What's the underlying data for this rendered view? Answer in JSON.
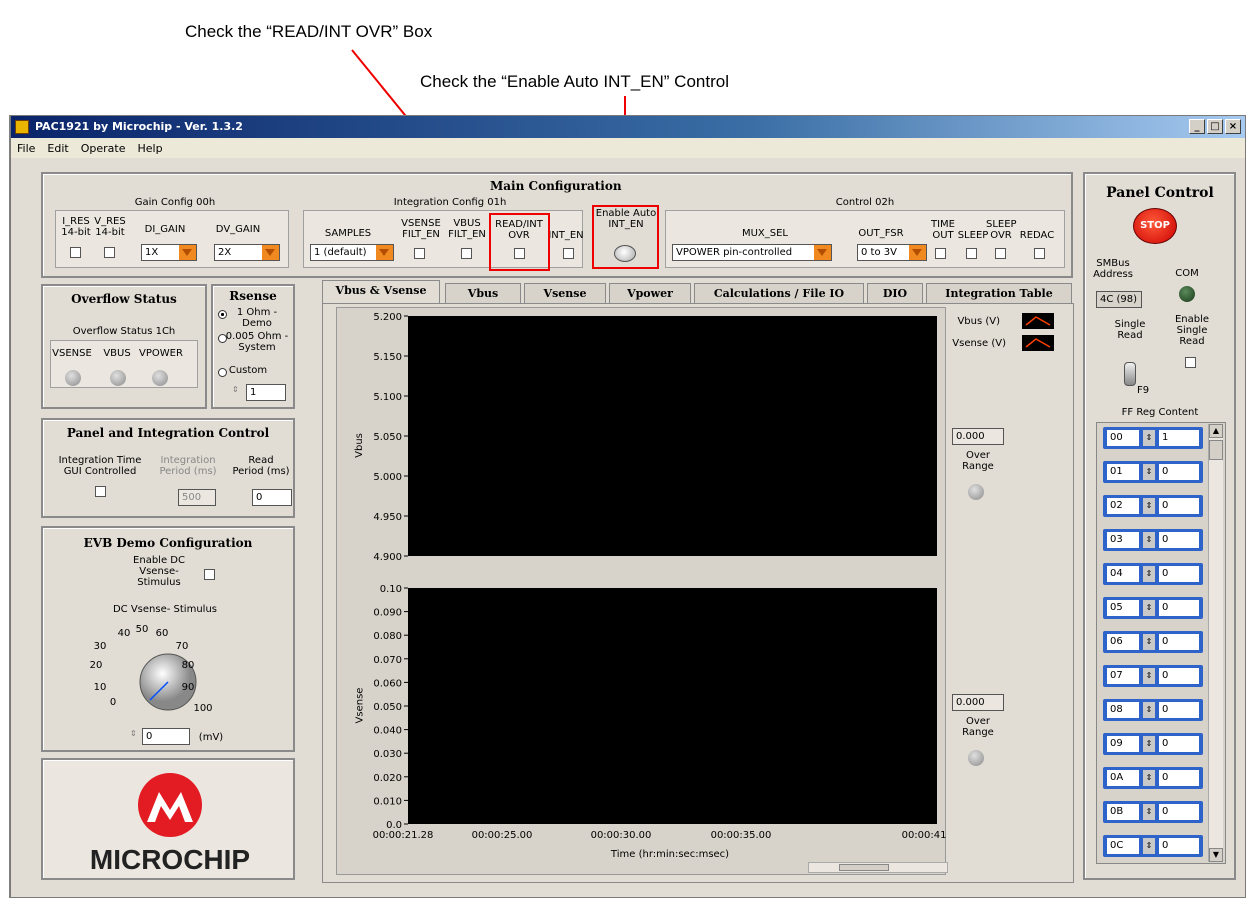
{
  "callouts": {
    "read_int_ovr": "Check the “READ/INT OVR” Box",
    "auto_int_en": "Check the “Enable Auto INT_EN” Control"
  },
  "window": {
    "title": "PAC1921 by Microchip - Ver. 1.3.2",
    "menu": [
      "File",
      "Edit",
      "Operate",
      "Help"
    ]
  },
  "main_config": {
    "title": "Main Configuration",
    "gain_title": "Gain Config 00h",
    "integ_title": "Integration Config 01h",
    "control_title": "Control 02h",
    "i_res": "I_RES\n14-bit",
    "v_res": "V_RES\n14-bit",
    "di_gain": "DI_GAIN",
    "di_gain_value": "1X",
    "dv_gain": "DV_GAIN",
    "dv_gain_value": "2X",
    "samples": "SAMPLES",
    "samples_value": "1 (default)",
    "vsense_filt": "VSENSE\nFILT_EN",
    "vbus_filt": "VBUS\nFILT_EN",
    "read_int": "READ/INT\nOVR",
    "int_en": "INT_EN",
    "auto_int": "Enable Auto\nINT_EN",
    "mux_sel": "MUX_SEL",
    "mux_value": "VPOWER pin-controlled",
    "out_fsr": "OUT_FSR",
    "out_fsr_value": "0 to 3V",
    "timeout": "TIME\nOUT",
    "sleep": "SLEEP",
    "sleep_ovr": "SLEEP\nOVR",
    "redac": "REDAC"
  },
  "overflow": {
    "title": "Overflow Status",
    "subtitle": "Overflow Status 1Ch",
    "leds": [
      "VSENSE",
      "VBUS",
      "VPOWER"
    ]
  },
  "rsense": {
    "title": "Rsense",
    "options": [
      "1 Ohm -\nDemo",
      "0.005 Ohm -\nSystem",
      "Custom"
    ],
    "value": "1"
  },
  "pic": {
    "title": "Panel and Integration Control",
    "integ_time": "Integration Time\nGUI Controlled",
    "integ_period": "Integration\nPeriod (ms)",
    "integ_period_value": "500",
    "read_period": "Read\nPeriod (ms)",
    "read_period_value": "0"
  },
  "evb": {
    "title": "EVB Demo Configuration",
    "enable_dc": "Enable DC\nVsense-\nStimulus",
    "dc_label": "DC Vsense- Stimulus",
    "knob_ticks": [
      "0",
      "10",
      "20",
      "30",
      "40",
      "50",
      "60",
      "70",
      "80",
      "90",
      "100"
    ],
    "value": "0",
    "unit": "(mV)"
  },
  "logo": {
    "text": "MICROCHIP"
  },
  "tabs": [
    "Vbus & Vsense",
    "Vbus",
    "Vsense",
    "Vpower",
    "Calculations / File IO",
    "DIO",
    "Integration Table"
  ],
  "chart_data": [
    {
      "type": "line",
      "ylabel": "Vbus",
      "ylim": [
        4.9,
        5.2
      ],
      "yticks": [
        "5.200",
        "5.150",
        "5.100",
        "5.050",
        "5.000",
        "4.950",
        "4.900"
      ],
      "series": [
        {
          "name": "Vbus (V)",
          "values": []
        },
        {
          "name": "Vsense (V)",
          "values": []
        }
      ]
    },
    {
      "type": "line",
      "ylabel": "Vsense",
      "ylim": [
        0.0,
        0.1
      ],
      "yticks": [
        "0.10",
        "0.090",
        "0.080",
        "0.070",
        "0.060",
        "0.050",
        "0.040",
        "0.030",
        "0.020",
        "0.010",
        "0.0"
      ],
      "xticks": [
        "00:00:21.28",
        "00:00:25.00",
        "00:00:30.00",
        "00:00:35.00",
        "00:00:41.28"
      ],
      "xlabel": "Time (hr:min:sec:msec)",
      "series": []
    }
  ],
  "legend": {
    "vbus": "Vbus (V)",
    "vsense": "Vsense (V)"
  },
  "readouts": {
    "vbus_value": "0.000",
    "vsense_value": "0.000",
    "over_range": "Over\nRange"
  },
  "panel_control": {
    "title": "Panel Control",
    "stop": "STOP",
    "smbus": "SMBus\nAddress",
    "smbus_value": "4C (98)",
    "com": "COM",
    "single_read": "Single\nRead",
    "enable_single": "Enable\nSingle\nRead",
    "f9": "F9",
    "ff_reg": "FF Reg Content",
    "regs": [
      {
        "addr": "00",
        "val": "1"
      },
      {
        "addr": "01",
        "val": "0"
      },
      {
        "addr": "02",
        "val": "0"
      },
      {
        "addr": "03",
        "val": "0"
      },
      {
        "addr": "04",
        "val": "0"
      },
      {
        "addr": "05",
        "val": "0"
      },
      {
        "addr": "06",
        "val": "0"
      },
      {
        "addr": "07",
        "val": "0"
      },
      {
        "addr": "08",
        "val": "0"
      },
      {
        "addr": "09",
        "val": "0"
      },
      {
        "addr": "0A",
        "val": "0"
      },
      {
        "addr": "0B",
        "val": "0"
      },
      {
        "addr": "0C",
        "val": "0"
      }
    ]
  }
}
